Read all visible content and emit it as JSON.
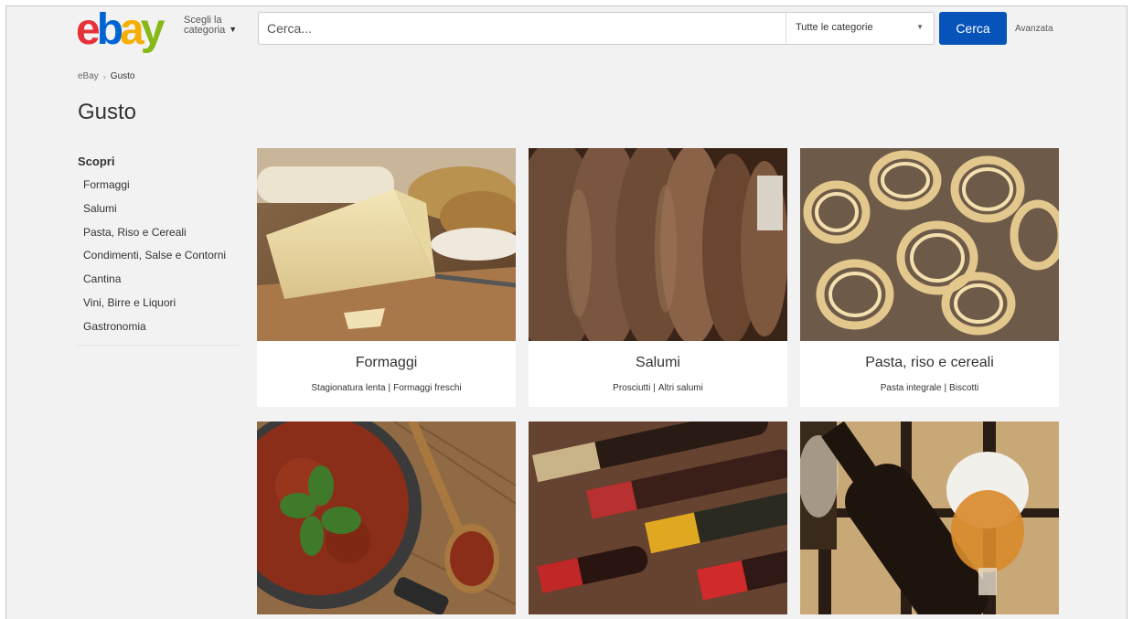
{
  "header": {
    "logo_text": "ebay",
    "shop_by_line1": "Scegli la",
    "shop_by_line2": "categoria",
    "search_placeholder": "Cerca...",
    "category_select": "Tutte le categorie",
    "search_button": "Cerca",
    "advanced_link": "Avanzata"
  },
  "breadcrumb": {
    "home": "eBay",
    "current": "Gusto"
  },
  "page_title": "Gusto",
  "sidebar": {
    "heading": "Scopri",
    "items": [
      {
        "label": "Formaggi"
      },
      {
        "label": "Salumi"
      },
      {
        "label": "Pasta, Riso e Cereali"
      },
      {
        "label": "Condimenti, Salse e Contorni"
      },
      {
        "label": "Cantina"
      },
      {
        "label": "Vini, Birre e Liquori"
      },
      {
        "label": "Gastronomia"
      }
    ]
  },
  "cards": [
    {
      "title": "Formaggi",
      "link1": "Stagionatura lenta",
      "link2": "Formaggi freschi",
      "image": "cheese-image"
    },
    {
      "title": "Salumi",
      "link1": "Prosciutti",
      "link2": "Altri salumi",
      "image": "ham-image"
    },
    {
      "title": "Pasta, riso e cereali",
      "link1": "Pasta integrale",
      "link2": "Biscotti",
      "image": "pasta-image"
    },
    {
      "title": "",
      "image": "sauce-image"
    },
    {
      "title": "",
      "image": "wine-image"
    },
    {
      "title": "",
      "image": "beer-image"
    }
  ],
  "colors": {
    "logo_e": "#e53238",
    "logo_b": "#0064d2",
    "logo_a": "#f5af02",
    "logo_y": "#86b817",
    "search_button": "#0654ba",
    "page_bg": "#f2f2f2"
  }
}
